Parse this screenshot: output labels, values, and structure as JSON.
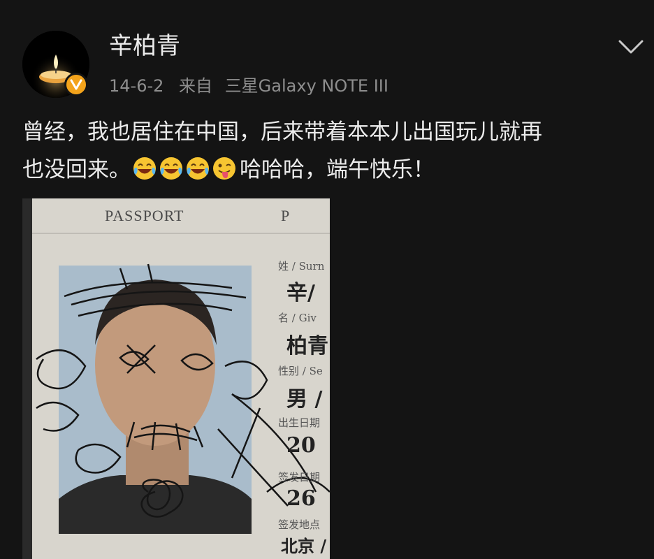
{
  "post": {
    "username": "辛柏青",
    "date": "14-6-2",
    "source_label": "来自",
    "source_device": "三星Galaxy NOTE III",
    "text_line1": "曾经，我也居住在中国，后来带着本本儿出国玩儿就再",
    "text_line2_start": "也没回来。",
    "text_line2_end": "哈哈哈，端午快乐！",
    "emojis": [
      "laugh-cry",
      "laugh-cry",
      "laugh-cry",
      "tongue-wink"
    ]
  },
  "photo": {
    "header_label": "PASSPORT",
    "header_type": "P",
    "surname_label": "姓 / Surn",
    "surname_value": "辛/",
    "given_label": "名 / Giv",
    "given_value": "柏青",
    "sex_label": "性别 / Se",
    "sex_value": "男 / M",
    "dob_label": "出生日期",
    "dob_value": "20",
    "issue_label": "签发日期",
    "issue_value": "26",
    "place_label": "签发地点",
    "place_value": "北京 /"
  },
  "colors": {
    "background": "#141414",
    "badge": "#f3a31b",
    "meta_text": "#8e8e8e"
  }
}
